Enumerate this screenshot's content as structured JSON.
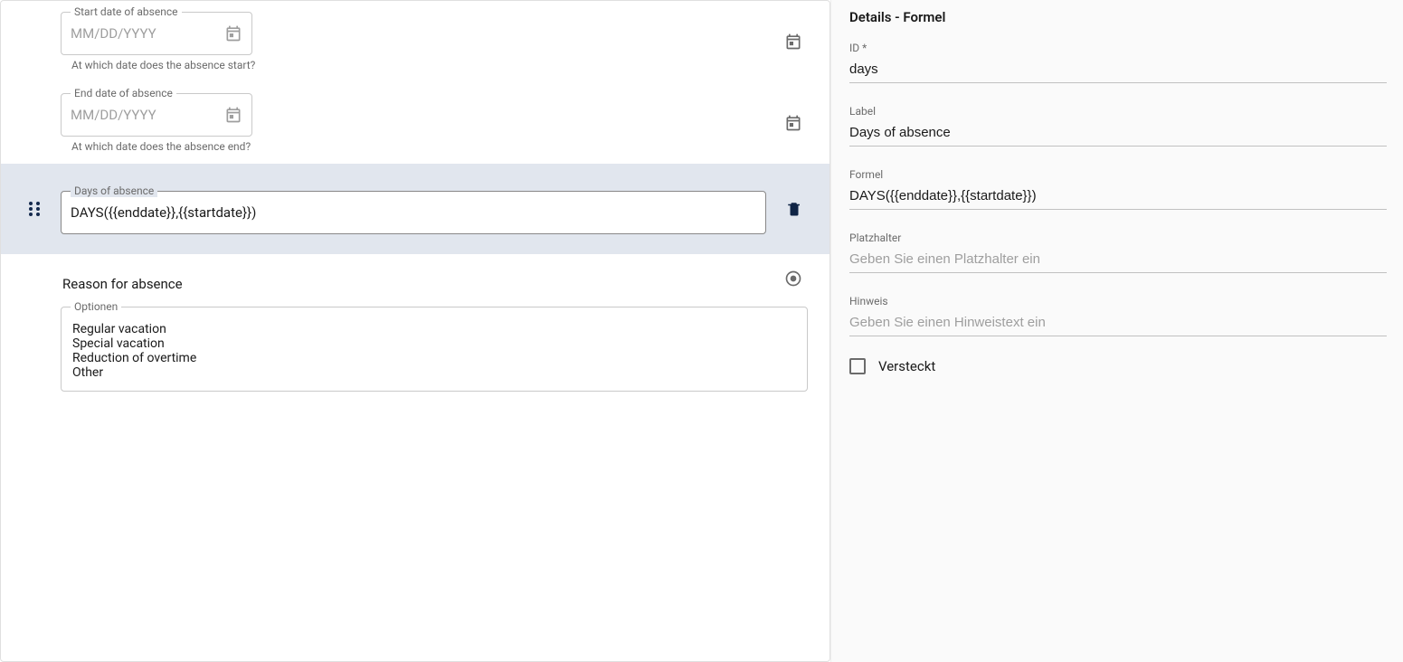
{
  "main": {
    "fields": {
      "start": {
        "label": "Start date of absence",
        "placeholder": "MM/DD/YYYY",
        "helper": "At which date does the absence start?"
      },
      "end": {
        "label": "End date of absence",
        "placeholder": "MM/DD/YYYY",
        "helper": "At which date does the absence end?"
      },
      "days": {
        "label": "Days of absence",
        "value": "DAYS({{enddate}},{{startdate}})"
      },
      "reason": {
        "heading": "Reason for absence",
        "options_label": "Optionen",
        "options": [
          "Regular vacation",
          "Special vacation",
          "Reduction of overtime",
          "Other"
        ]
      }
    }
  },
  "side": {
    "title": "Details - Formel",
    "id_label": "ID *",
    "id_value": "days",
    "label_label": "Label",
    "label_value": "Days of absence",
    "formel_label": "Formel",
    "formel_value": "DAYS({{enddate}},{{startdate}})",
    "placeholder_label": "Platzhalter",
    "placeholder_placeholder": "Geben Sie einen Platzhalter ein",
    "hint_label": "Hinweis",
    "hint_placeholder": "Geben Sie einen Hinweistext ein",
    "hidden_label": "Versteckt"
  }
}
